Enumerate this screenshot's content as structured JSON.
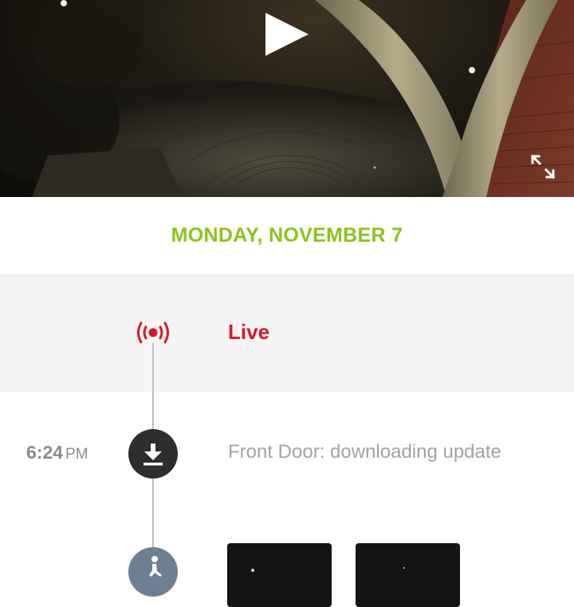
{
  "video": {
    "play_icon": "play-icon",
    "expand_icon": "expand-icon",
    "scene_colors": {
      "arch": "#a29a78",
      "brick": "#6b3024",
      "sky": "#0c0b08"
    }
  },
  "header": {
    "date": "MONDAY, NOVEMBER 7",
    "date_color": "#8cc21c"
  },
  "timeline": {
    "live": {
      "icon": "live-broadcast-icon",
      "label": "Live",
      "color": "#d31a2b"
    },
    "events": [
      {
        "time": "6:24",
        "ampm": "PM",
        "icon": "download-icon",
        "description": "Front Door: downloading update"
      },
      {
        "icon": "motion-person-icon",
        "thumbnails": [
          "thumbnail-1",
          "thumbnail-2"
        ]
      }
    ]
  }
}
